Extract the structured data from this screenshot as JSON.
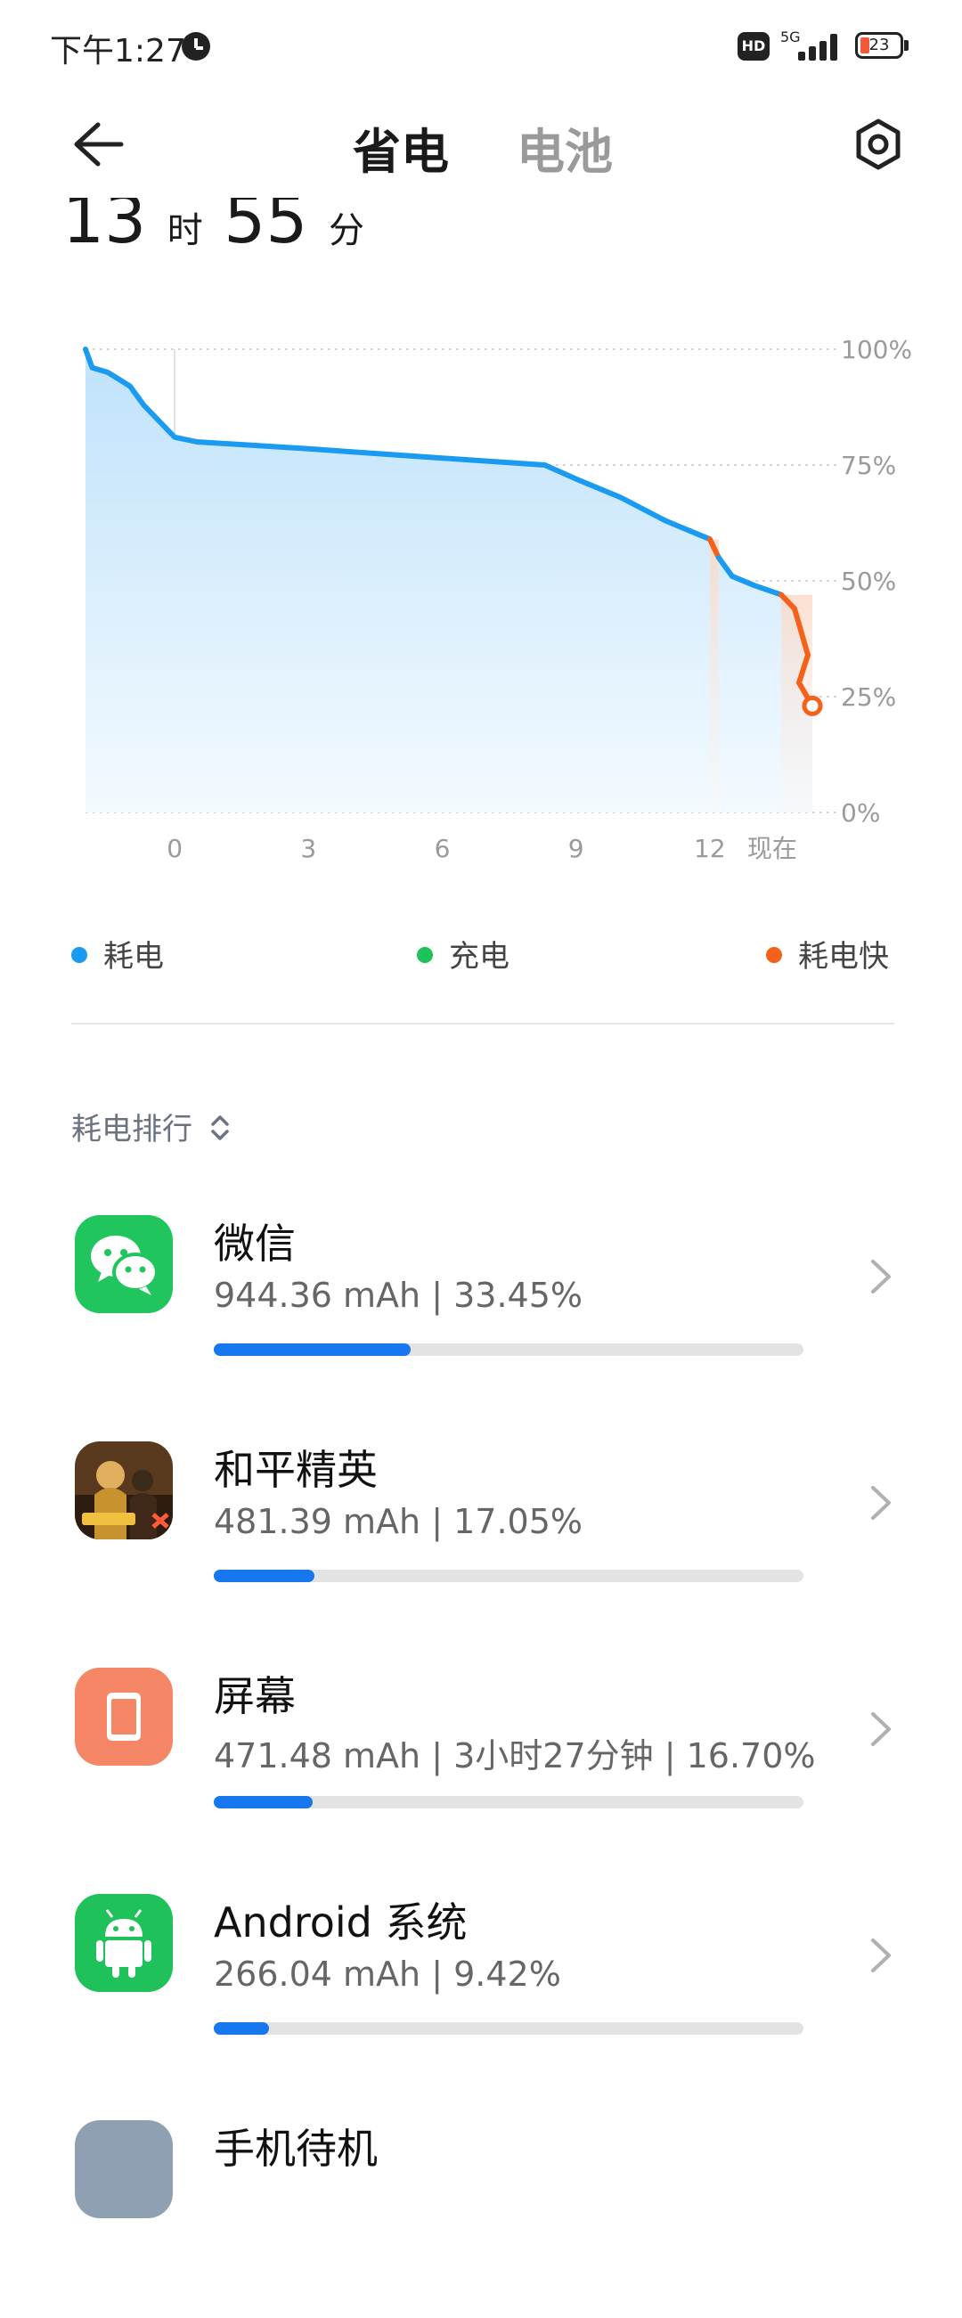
{
  "status": {
    "time": "下午1:27",
    "hd": "HD",
    "network": "5G",
    "battery": "23"
  },
  "header": {
    "tab_active": "省电",
    "tab_inactive": "电池"
  },
  "summary": {
    "hours": "13",
    "hours_unit": "时",
    "minutes": "55",
    "minutes_unit": "分"
  },
  "chart_data": {
    "type": "area",
    "title": "",
    "xlabel": "",
    "ylabel": "",
    "x_tick_labels": [
      "0",
      "3",
      "6",
      "9",
      "12",
      "现在"
    ],
    "y_tick_labels": [
      "100%",
      "75%",
      "50%",
      "25%",
      "0%"
    ],
    "ylim": [
      0,
      100
    ],
    "grid": true,
    "series": [
      {
        "name": "耗电",
        "color": "#1a9bf0",
        "points": [
          [
            -2.0,
            100
          ],
          [
            -1.85,
            96
          ],
          [
            -1.5,
            95
          ],
          [
            -1.0,
            92
          ],
          [
            -0.7,
            88
          ],
          [
            0,
            81
          ],
          [
            0.5,
            80
          ],
          [
            3,
            78.5
          ],
          [
            6,
            76.5
          ],
          [
            8.3,
            75
          ],
          [
            9,
            72
          ],
          [
            10,
            68
          ],
          [
            11,
            63
          ],
          [
            12.0,
            59
          ]
        ]
      },
      {
        "name": "耗电快",
        "color": "#f5611a",
        "points": [
          [
            12.0,
            59
          ],
          [
            12.2,
            55
          ]
        ]
      },
      {
        "name": "耗电",
        "color": "#1a9bf0",
        "points": [
          [
            12.2,
            55
          ],
          [
            12.5,
            51
          ],
          [
            13.0,
            49
          ],
          [
            13.6,
            47
          ]
        ]
      },
      {
        "name": "耗电快",
        "color": "#f5611a",
        "points": [
          [
            13.6,
            47
          ],
          [
            13.9,
            44
          ],
          [
            14.2,
            34
          ],
          [
            14.0,
            28
          ],
          [
            14.3,
            23
          ]
        ]
      }
    ],
    "legend": [
      {
        "label": "耗电",
        "color": "#1a9bf0"
      },
      {
        "label": "充电",
        "color": "#1fc15a"
      },
      {
        "label": "耗电快",
        "color": "#f5611a"
      }
    ]
  },
  "ranking": {
    "title": "耗电排行",
    "items": [
      {
        "name": "微信",
        "stat": "944.36 mAh | 33.45%",
        "progress": 0.3345,
        "icon": "wechat-icon",
        "color": "#21c55e"
      },
      {
        "name": "和平精英",
        "stat": "481.39 mAh | 17.05%",
        "progress": 0.1705,
        "icon": "game-icon",
        "color": "#b8862c"
      },
      {
        "name": "屏幕",
        "stat": "471.48 mAh | 3小时27分钟 | 16.70%",
        "progress": 0.167,
        "icon": "screen-icon",
        "color": "#f58666"
      },
      {
        "name": "Android 系统",
        "stat": "266.04 mAh | 9.42%",
        "progress": 0.0942,
        "icon": "android-icon",
        "color": "#1fc15a"
      },
      {
        "name": "手机待机",
        "stat": "",
        "progress": 0,
        "icon": "standby-icon",
        "color": "#8fa0b2"
      }
    ]
  }
}
